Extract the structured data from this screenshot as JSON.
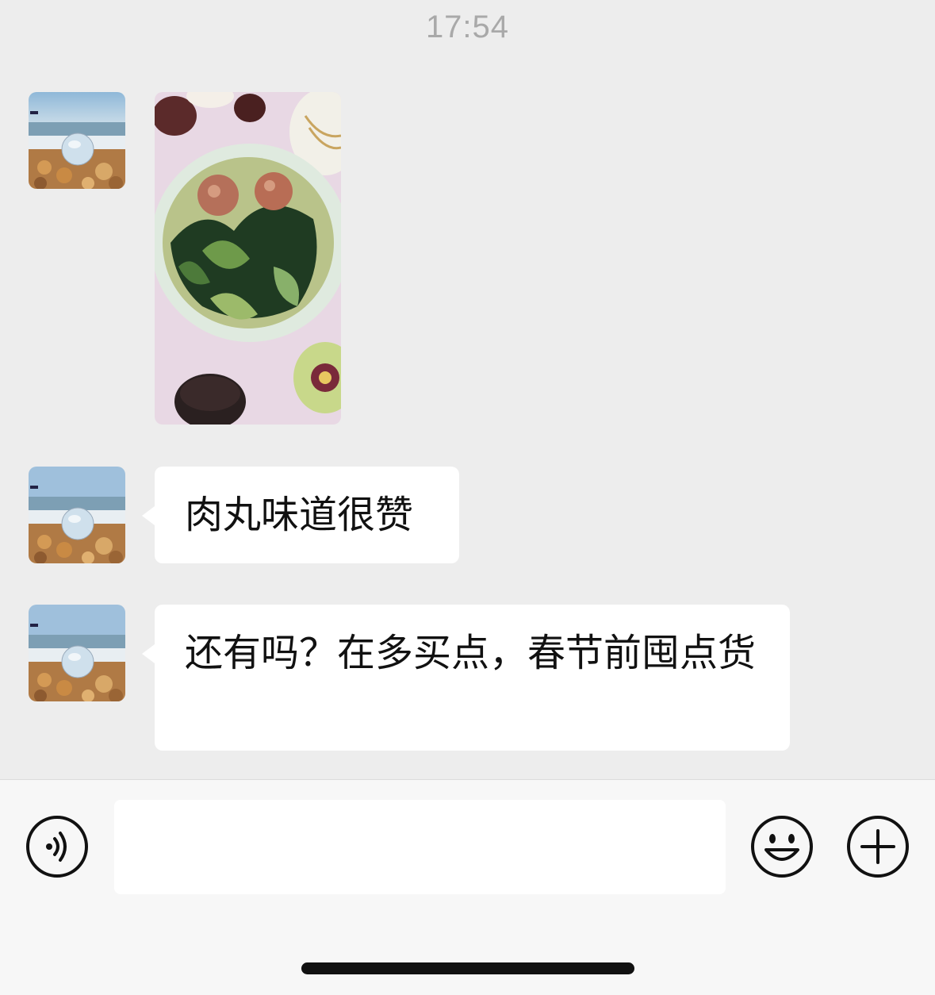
{
  "timestamp": "17:54",
  "messages": [
    {
      "type": "image",
      "alt_icon": "food-photo-meatball-soup"
    },
    {
      "type": "text",
      "text": "肉丸味道很赞"
    },
    {
      "type": "text",
      "text": "还有吗？在多买点，春节前囤点货"
    }
  ],
  "input": {
    "value": "",
    "placeholder": ""
  },
  "toolbar": {
    "voice_icon": "voice-icon",
    "emoji_icon": "emoji-icon",
    "plus_icon": "plus-icon"
  },
  "colors": {
    "background": "#ededed",
    "bubble": "#ffffff",
    "timestamp": "#a9a9a9",
    "bar": "#f7f7f7"
  }
}
